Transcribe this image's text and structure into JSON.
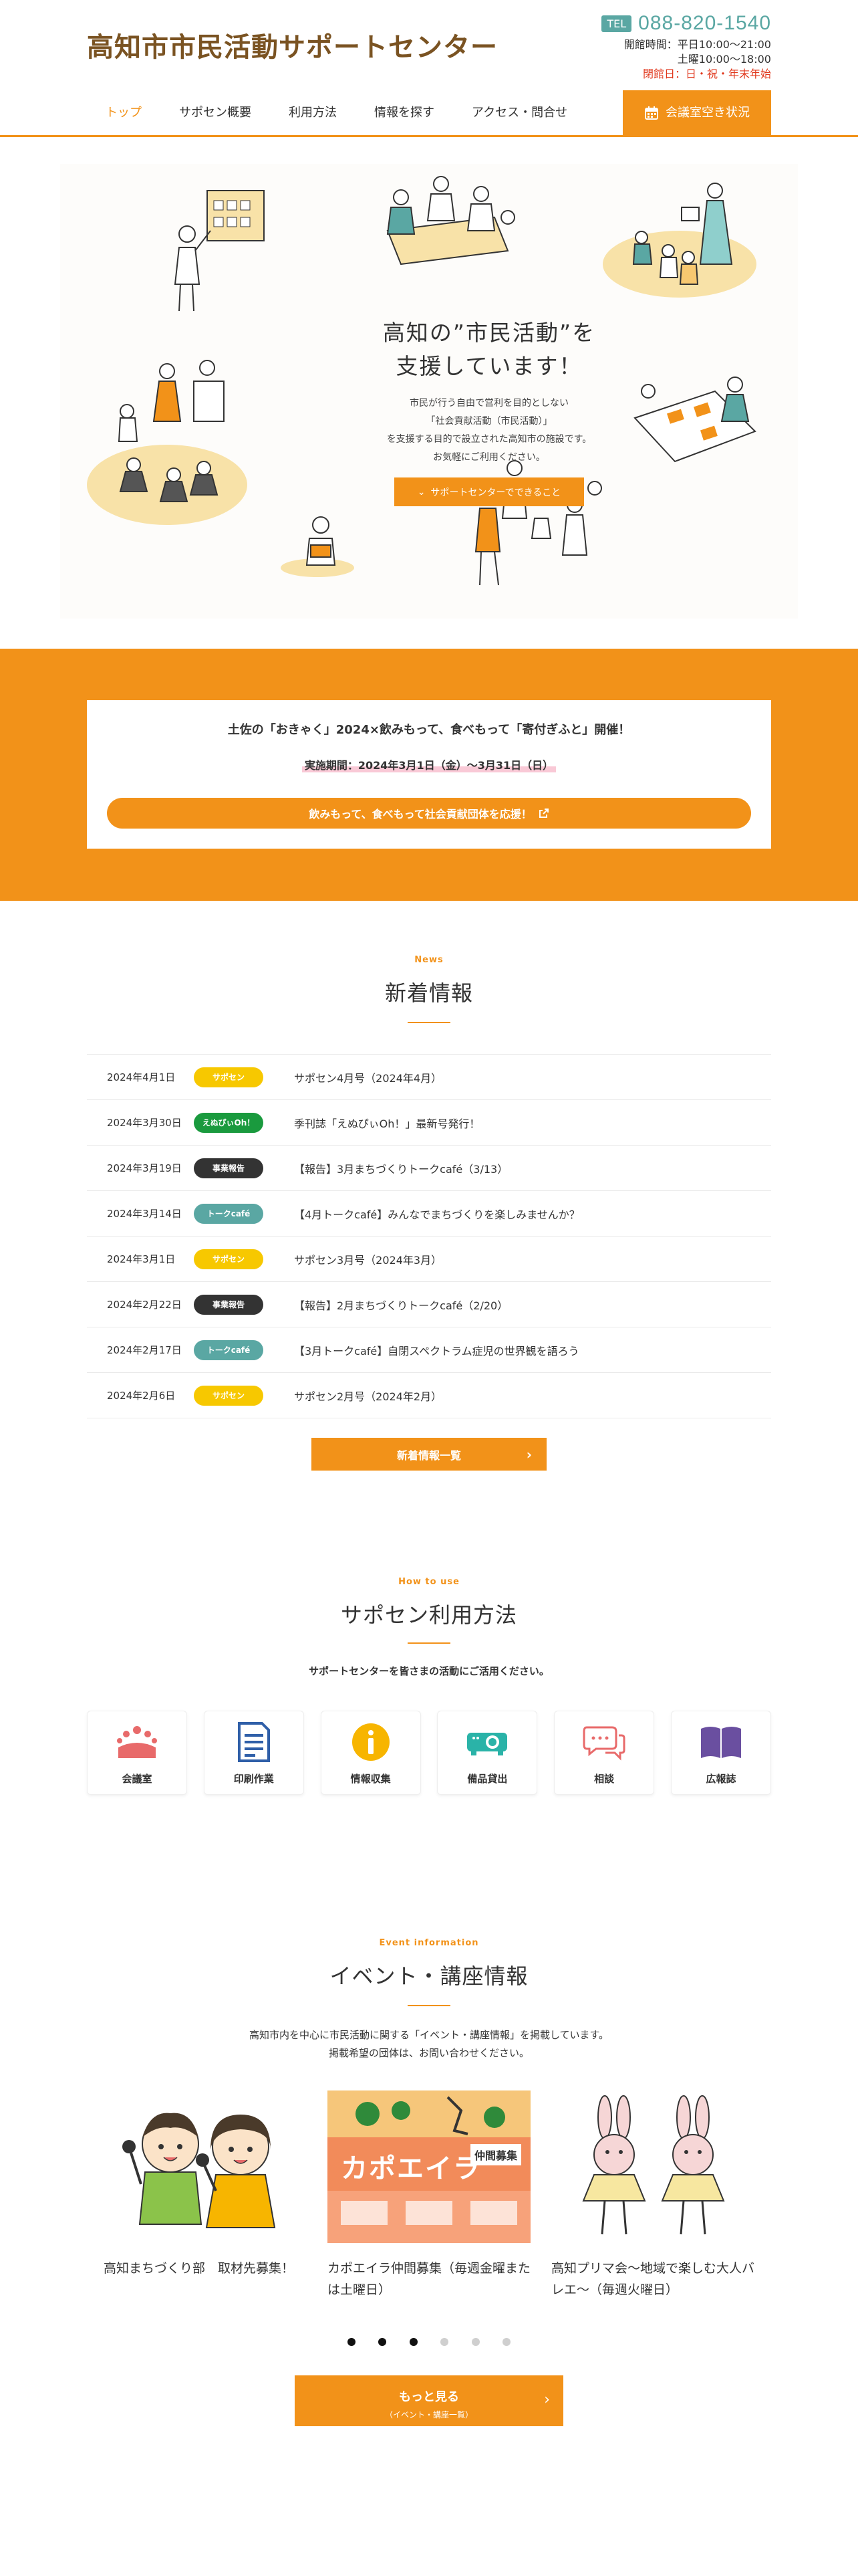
{
  "header": {
    "logo": "高知市市民活動サポートセンター",
    "tel_badge": "TEL",
    "tel": "088-820-1540",
    "hours_label": "開館時間：",
    "hours_weekday": "平日10:00〜21:00",
    "hours_sat": "土曜10:00〜18:00",
    "closed": "閉館日：日・祝・年末年始"
  },
  "nav": {
    "items": [
      "トップ",
      "サポセン概要",
      "利用方法",
      "情報を探す",
      "アクセス・問合せ"
    ],
    "room_button": "会議室空き状況"
  },
  "hero": {
    "title_line1": "高知の”市民活動”を",
    "title_line2": "支援しています！",
    "text_line1": "市民が行う自由で営利を目的としない",
    "text_line2": "「社会貢献活動（市民活動）」",
    "text_line3": "を支援する目的で設立された高知市の施設です。",
    "text_line4": "お気軽にご利用ください。",
    "button": "サポートセンターでできること"
  },
  "band": {
    "title": "土佐の「おきゃく」2024×飲みもって、食べもって「寄付ぎふと」開催！",
    "period": "実施期間：2024年3月1日（金）〜3月31日（日）",
    "button": "飲みもって、食べもって社会貢献団体を応援！"
  },
  "news": {
    "en": "News",
    "ja": "新着情報",
    "rows": [
      {
        "date": "2024年4月1日",
        "cat": "サポセン",
        "title": "サポセン4月号（2024年4月）"
      },
      {
        "date": "2024年3月30日",
        "cat": "えぬぴぃOh！",
        "title": "季刊誌「えぬぴぃOh！」最新号発行！"
      },
      {
        "date": "2024年3月19日",
        "cat": "事業報告",
        "title": "【報告】3月まちづくりトークcafé（3/13）"
      },
      {
        "date": "2024年3月14日",
        "cat": "トークcafé",
        "title": "【4月トークcafé】みんなでまちづくりを楽しみませんか？"
      },
      {
        "date": "2024年3月1日",
        "cat": "サポセン",
        "title": "サポセン3月号（2024年3月）"
      },
      {
        "date": "2024年2月22日",
        "cat": "事業報告",
        "title": "【報告】2月まちづくりトークcafé（2/20）"
      },
      {
        "date": "2024年2月17日",
        "cat": "トークcafé",
        "title": "【3月トークcafé】自閉スペクトラム症児の世界観を語ろう"
      },
      {
        "date": "2024年2月6日",
        "cat": "サポセン",
        "title": "サポセン2月号（2024年2月）"
      }
    ],
    "more": "新着情報一覧"
  },
  "howto": {
    "en": "How to use",
    "ja": "サポセン利用方法",
    "lead": "サポートセンターを皆さまの活動にご活用ください。",
    "items": [
      "会議室",
      "印刷作業",
      "情報収集",
      "備品貸出",
      "相談",
      "広報誌"
    ]
  },
  "events": {
    "en": "Event information",
    "ja": "イベント・講座情報",
    "lead1": "高知市内を中心に市民活動に関する「イベント・講座情報」を掲載しています。",
    "lead2": "掲載希望の団体は、お問い合わせください。",
    "cards": [
      {
        "title": "高知まちづくり部　取材先募集！"
      },
      {
        "title": "カポエイラ仲間募集（毎週金曜または土曜日）",
        "poster": "カポエイラ",
        "poster_sub": "仲間募集"
      },
      {
        "title": "高知プリマ会〜地域で楽しむ大人バレエ〜（毎週火曜日）"
      }
    ],
    "more1": "もっと見る",
    "more2": "（イベント・講座一覧）"
  },
  "colors": {
    "accent": "#f29219",
    "teal": "#5aa7a3",
    "cat_sapo": "#f7c800",
    "cat_npo": "#1a9a3e",
    "cat_report": "#333333",
    "cat_cafe": "#5aa7a3"
  }
}
